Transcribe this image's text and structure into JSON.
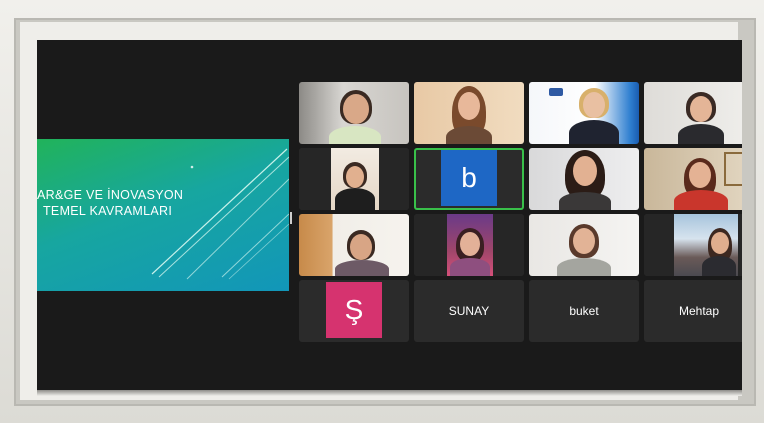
{
  "slide": {
    "title_line1": "AR&GE  VE İNOVASYON",
    "title_line2": "TEMEL KAVRAMLARI"
  },
  "participants": [
    {
      "id": "p1",
      "type": "video"
    },
    {
      "id": "p2",
      "type": "video"
    },
    {
      "id": "p3",
      "type": "video"
    },
    {
      "id": "p4",
      "type": "video"
    },
    {
      "id": "p5",
      "type": "video"
    },
    {
      "id": "p6",
      "type": "avatar",
      "letter": "b",
      "color": "#1e67c5",
      "active": true
    },
    {
      "id": "p7",
      "type": "video"
    },
    {
      "id": "p8",
      "type": "video"
    },
    {
      "id": "p9",
      "type": "video"
    },
    {
      "id": "p10",
      "type": "video"
    },
    {
      "id": "p11",
      "type": "video"
    },
    {
      "id": "p12",
      "type": "video"
    },
    {
      "id": "p13",
      "type": "avatar",
      "letter": "Ş",
      "color": "#d6336f"
    },
    {
      "id": "p14",
      "type": "name",
      "name": "SUNAY"
    },
    {
      "id": "p15",
      "type": "name",
      "name": "buket"
    },
    {
      "id": "p16",
      "type": "name",
      "name": "Mehtap"
    }
  ],
  "colors": {
    "active_speaker_border": "#39c04a",
    "tile_background": "#2b2b2b",
    "meeting_background": "#1a1a1a"
  }
}
